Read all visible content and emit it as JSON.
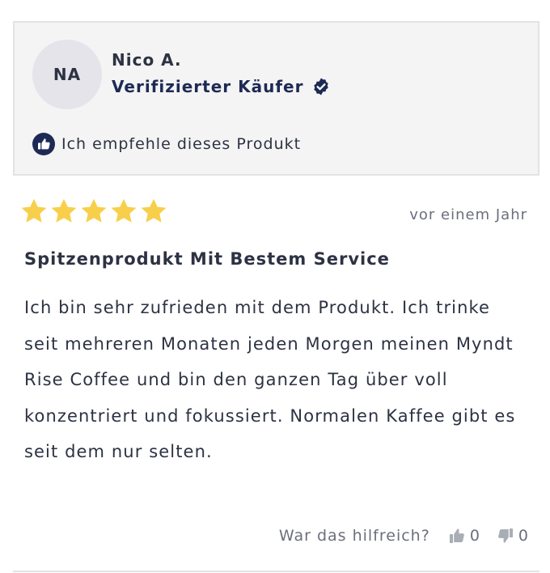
{
  "reviewer": {
    "initials": "NA",
    "name": "Nico A.",
    "verified_label": "Verifizierter Käufer",
    "recommend_text": "Ich empfehle dieses Produkt"
  },
  "review": {
    "rating": 5,
    "rating_max": 5,
    "date": "vor einem Jahr",
    "title": "Spitzenprodukt Mit Bestem Service",
    "body": "Ich bin sehr zufrieden mit dem Produkt. Ich trinke seit mehreren Monaten jeden Morgen meinen Myndt Rise Coffee und bin den ganzen Tag über voll konzentriert und fokussiert. Normalen Kaffee gibt es seit dem nur selten."
  },
  "helpful": {
    "label": "War das hilfreich?",
    "up_count": "0",
    "down_count": "0"
  },
  "icons": {
    "verified": "check-badge-icon",
    "recommend": "thumbs-up-circle-icon",
    "star": "star-icon",
    "vote_up": "thumbs-up-icon",
    "vote_down": "thumbs-down-icon"
  },
  "colors": {
    "brand_navy": "#1d2a55",
    "text": "#2d3243",
    "muted": "#6b6f7c",
    "star": "#f8cf4a",
    "card_bg": "#f4f4f4",
    "vote_icon": "#a9adb5"
  }
}
